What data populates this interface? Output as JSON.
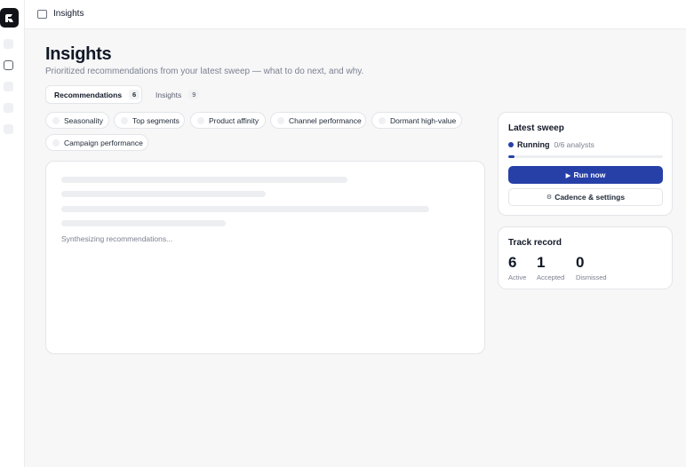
{
  "topbar": {
    "title": "Insights"
  },
  "header": {
    "title": "Insights",
    "subtitle": "Prioritized recommendations from your latest sweep — what to do next, and why."
  },
  "tabs": [
    {
      "label": "Recommendations",
      "count": "6",
      "active": true
    },
    {
      "label": "Insights",
      "count": "9",
      "active": false
    }
  ],
  "chips": [
    {
      "label": "Seasonality"
    },
    {
      "label": "Top segments"
    },
    {
      "label": "Product affinity"
    },
    {
      "label": "Channel performance"
    },
    {
      "label": "Dormant high-value"
    },
    {
      "label": "Campaign performance"
    }
  ],
  "main": {
    "status_text": "Synthesizing recommendations..."
  },
  "sweep": {
    "title": "Latest sweep",
    "status_label": "Running",
    "status_count": "0/6 analysts",
    "progress_fraction": 0.04,
    "run_label": "Run now",
    "cadence_label": "Cadence & settings"
  },
  "track": {
    "title": "Track record",
    "stats": [
      {
        "value": "6",
        "label": "Active"
      },
      {
        "value": "1",
        "label": "Accepted"
      },
      {
        "value": "0",
        "label": "Dismissed"
      }
    ]
  },
  "icons": {
    "logo": "brand-logo-icon",
    "sidebar_toggle": "sidebar-toggle-icon",
    "play": "play-icon",
    "gear": "gear-icon"
  },
  "colors": {
    "accent": "#2640a8",
    "logo_bg": "#111318",
    "muted_text": "#7b8190"
  }
}
